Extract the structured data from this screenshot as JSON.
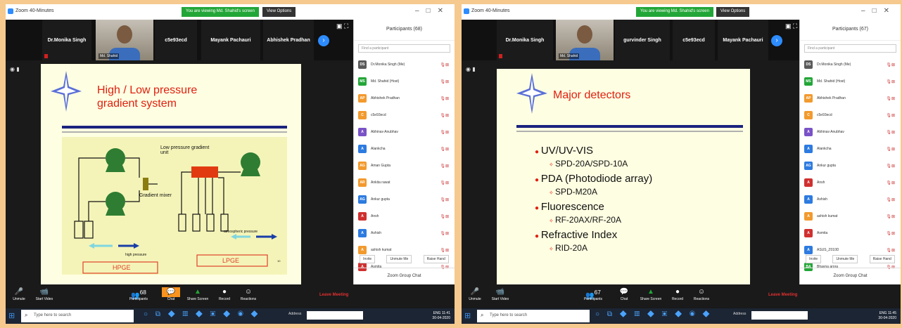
{
  "left": {
    "title": "Zoom 40-Minutes",
    "banner": "You are viewing Md. Shahid's screen",
    "view_options": "View Options",
    "gallery": [
      "Dr.Monika Singh",
      "c5e93ecd",
      "Mayank Pachauri",
      "Abhishek Pradhan"
    ],
    "video_name": "Md. Shahid",
    "slide_title": "High / Low pressure gradient system",
    "diagram": {
      "low_unit": "Low pressure gradient unit",
      "mixer": "Gradient mixer",
      "high_pressure": "high pressure",
      "atm_pressure": "atmospheric pressure",
      "hpge": "HPGE",
      "lpge": "LPGE",
      "page": "10"
    },
    "participants_header": "Participants (68)",
    "search_placeholder": "Find a participant",
    "participants": [
      {
        "initials": "DS",
        "name": "Dr.Monika Singh (Me)",
        "color": "#5a5a5a"
      },
      {
        "initials": "MS",
        "name": "Md. Shahid (Host)",
        "color": "#23a638"
      },
      {
        "initials": "AP",
        "name": "Abhishek Pradhan",
        "color": "#f29a2e"
      },
      {
        "initials": "C",
        "name": "c5e93ecd",
        "color": "#f29a2e"
      },
      {
        "initials": "A",
        "name": "Abhinav Anubhav",
        "color": "#7a52c7"
      },
      {
        "initials": "A",
        "name": "Alankcha",
        "color": "#2d7be0"
      },
      {
        "initials": "AG",
        "name": "Aman Gupta",
        "color": "#f29a2e"
      },
      {
        "initials": "AR",
        "name": "Ankita rawat",
        "color": "#f29a2e"
      },
      {
        "initials": "AG",
        "name": "Ankur gupta",
        "color": "#2d7be0"
      },
      {
        "initials": "A",
        "name": "Ansh",
        "color": "#d03030"
      },
      {
        "initials": "A",
        "name": "Ashish",
        "color": "#2d7be0"
      },
      {
        "initials": "A",
        "name": "ashish kumat",
        "color": "#f29a2e"
      },
      {
        "initials": "A",
        "name": "Asmita",
        "color": "#d03030"
      }
    ],
    "footer": [
      "Invite",
      "Unmute Me",
      "Raise Hand"
    ],
    "chat_title": "Zoom Group Chat",
    "toolbar": {
      "unmute": "Unmute",
      "start_video": "Start Video",
      "participants": "Participants",
      "participants_count": "68",
      "chat": "Chat",
      "share": "Share Screen",
      "record": "Record",
      "reactions": "Reactions",
      "leave": "Leave Meeting"
    },
    "taskbar": {
      "search": "Type here to search",
      "address": "Address",
      "lang": "ENG",
      "time": "11:41",
      "date": "30-04-2020"
    }
  },
  "right": {
    "title": "Zoom 40-Minutes",
    "banner": "You are viewing Md. Shahid's screen",
    "view_options": "View Options",
    "gallery": [
      "Dr.Monika Singh",
      "gurvinder Singh",
      "c5e93ecd",
      "Mayank Pachauri"
    ],
    "video_name": "Md. Shahid",
    "slide_title": "Major detectors",
    "bullets": [
      {
        "main": "UV/UV-VIS",
        "sub": "SPD-20A/SPD-10A"
      },
      {
        "main": "PDA (Photodiode array)",
        "sub": "SPD-M20A"
      },
      {
        "main": "Fluorescence",
        "sub": "RF-20AX/RF-20A"
      },
      {
        "main": "Refractive Index",
        "sub": "RID-20A"
      }
    ],
    "participants_header": "Participants (67)",
    "search_placeholder": "Find a participant",
    "participants": [
      {
        "initials": "DS",
        "name": "Dr.Monika Singh (Me)",
        "color": "#5a5a5a"
      },
      {
        "initials": "MS",
        "name": "Md. Shahid (Host)",
        "color": "#23a638"
      },
      {
        "initials": "AP",
        "name": "Abhishek Pradhan",
        "color": "#f29a2e"
      },
      {
        "initials": "C",
        "name": "c5e93ecd",
        "color": "#f29a2e"
      },
      {
        "initials": "A",
        "name": "Abhinav Anubhav",
        "color": "#7a52c7"
      },
      {
        "initials": "A",
        "name": "Alankcha",
        "color": "#2d7be0"
      },
      {
        "initials": "AG",
        "name": "Ankur gupta",
        "color": "#2d7be0"
      },
      {
        "initials": "A",
        "name": "Ansh",
        "color": "#d03030"
      },
      {
        "initials": "A",
        "name": "Ashish",
        "color": "#2d7be0"
      },
      {
        "initials": "A",
        "name": "ashish kumat",
        "color": "#f29a2e"
      },
      {
        "initials": "A",
        "name": "Asmita",
        "color": "#d03030"
      },
      {
        "initials": "A",
        "name": "ASUS_Z010D",
        "color": "#2d7be0"
      },
      {
        "initials": "BA",
        "name": "Bhavna arora",
        "color": "#23a638"
      }
    ],
    "footer": [
      "Invite",
      "Unmute Me",
      "Raise Hand"
    ],
    "chat_title": "Zoom Group Chat",
    "toolbar": {
      "unmute": "Unmute",
      "start_video": "Start Video",
      "participants": "Participants",
      "participants_count": "67",
      "chat": "Chat",
      "share": "Share Screen",
      "record": "Record",
      "reactions": "Reactions",
      "leave": "Leave Meeting"
    },
    "taskbar": {
      "search": "Type here to search",
      "address": "Address",
      "lang": "ENG",
      "time": "11:45",
      "date": "30-04-2020"
    }
  }
}
